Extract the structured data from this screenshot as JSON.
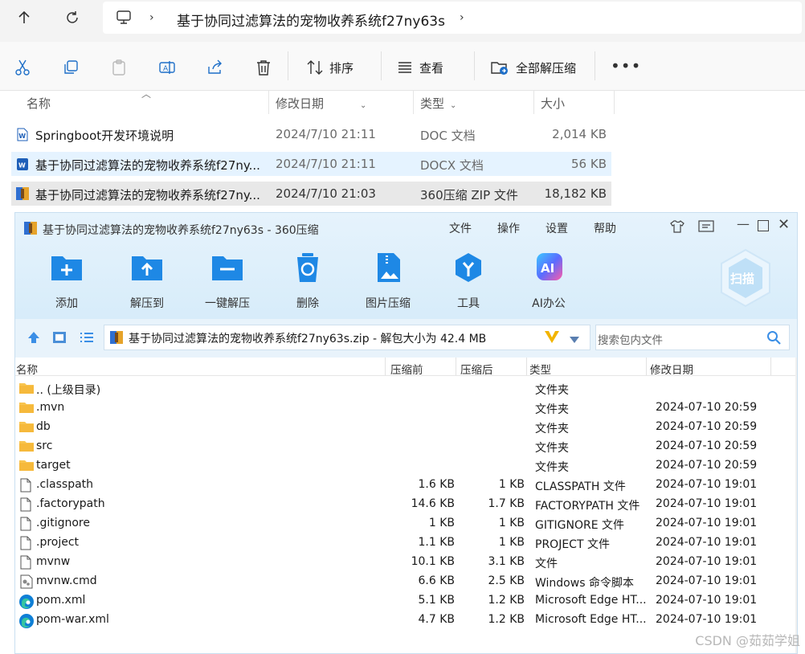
{
  "explorer": {
    "breadcrumb": "基于协同过滤算法的宠物收养系统f27ny63s",
    "toolbar": {
      "sort_label": "排序",
      "view_label": "查看",
      "extract_all_label": "全部解压缩"
    },
    "columns": [
      "名称",
      "修改日期",
      "类型",
      "大小"
    ],
    "files": [
      {
        "name": "Springboot开发环境说明",
        "date": "2024/7/10 21:11",
        "type": "DOC 文档",
        "size": "2,014 KB"
      },
      {
        "name": "基于协同过滤算法的宠物收养系统f27ny...",
        "date": "2024/7/10 21:11",
        "type": "DOCX 文档",
        "size": "56 KB"
      },
      {
        "name": "基于协同过滤算法的宠物收养系统f27ny...",
        "date": "2024/7/10 21:03",
        "type": "360压缩 ZIP 文件",
        "size": "18,182 KB"
      }
    ]
  },
  "archive": {
    "title": "基于协同过滤算法的宠物收养系统f27ny63s - 360压缩",
    "menu": [
      "文件",
      "操作",
      "设置",
      "帮助"
    ],
    "tools": [
      {
        "label": "添加",
        "icon": "add-folder-icon"
      },
      {
        "label": "解压到",
        "icon": "extract-to-icon"
      },
      {
        "label": "一键解压",
        "icon": "one-click-extract-icon"
      },
      {
        "label": "删除",
        "icon": "recycle-delete-icon"
      },
      {
        "label": "图片压缩",
        "icon": "image-compress-icon"
      },
      {
        "label": "工具",
        "icon": "tools-icon"
      },
      {
        "label": "AI办公",
        "icon": "ai-office-icon"
      }
    ],
    "scan_label": "扫描",
    "path": "基于协同过滤算法的宠物收养系统f27ny63s.zip - 解包大小为 42.4 MB",
    "search_placeholder": "搜索包内文件",
    "columns": [
      "名称",
      "压缩前",
      "压缩后",
      "类型",
      "修改日期"
    ],
    "entries": [
      {
        "name": ".. (上级目录)",
        "before": "",
        "after": "",
        "type": "文件夹",
        "date": "",
        "icon": "folder"
      },
      {
        "name": ".mvn",
        "before": "",
        "after": "",
        "type": "文件夹",
        "date": "2024-07-10 20:59",
        "icon": "folder"
      },
      {
        "name": "db",
        "before": "",
        "after": "",
        "type": "文件夹",
        "date": "2024-07-10 20:59",
        "icon": "folder"
      },
      {
        "name": "src",
        "before": "",
        "after": "",
        "type": "文件夹",
        "date": "2024-07-10 20:59",
        "icon": "folder"
      },
      {
        "name": "target",
        "before": "",
        "after": "",
        "type": "文件夹",
        "date": "2024-07-10 20:59",
        "icon": "folder"
      },
      {
        "name": ".classpath",
        "before": "1.6 KB",
        "after": "1 KB",
        "type": "CLASSPATH 文件",
        "date": "2024-07-10 19:01",
        "icon": "file"
      },
      {
        "name": ".factorypath",
        "before": "14.6 KB",
        "after": "1.7 KB",
        "type": "FACTORYPATH 文件",
        "date": "2024-07-10 19:01",
        "icon": "file"
      },
      {
        "name": ".gitignore",
        "before": "1 KB",
        "after": "1 KB",
        "type": "GITIGNORE 文件",
        "date": "2024-07-10 19:01",
        "icon": "file"
      },
      {
        "name": ".project",
        "before": "1.1 KB",
        "after": "1 KB",
        "type": "PROJECT 文件",
        "date": "2024-07-10 19:01",
        "icon": "file"
      },
      {
        "name": "mvnw",
        "before": "10.1 KB",
        "after": "3.1 KB",
        "type": "文件",
        "date": "2024-07-10 19:01",
        "icon": "file"
      },
      {
        "name": "mvnw.cmd",
        "before": "6.6 KB",
        "after": "2.5 KB",
        "type": "Windows 命令脚本",
        "date": "2024-07-10 19:01",
        "icon": "cmd"
      },
      {
        "name": "pom.xml",
        "before": "5.1 KB",
        "after": "1.2 KB",
        "type": "Microsoft Edge HT...",
        "date": "2024-07-10 19:01",
        "icon": "edge"
      },
      {
        "name": "pom-war.xml",
        "before": "4.7 KB",
        "after": "1.2 KB",
        "type": "Microsoft Edge HT...",
        "date": "2024-07-10 19:01",
        "icon": "edge"
      }
    ]
  },
  "watermark": "CSDN @茹茹学姐",
  "colors": {
    "accent": "#1e88e5",
    "selection": "#e5f3ff",
    "selection_gray": "#e8e8e8",
    "folder": "#f8c44e",
    "ribbon_bg": "#dcedfa"
  }
}
